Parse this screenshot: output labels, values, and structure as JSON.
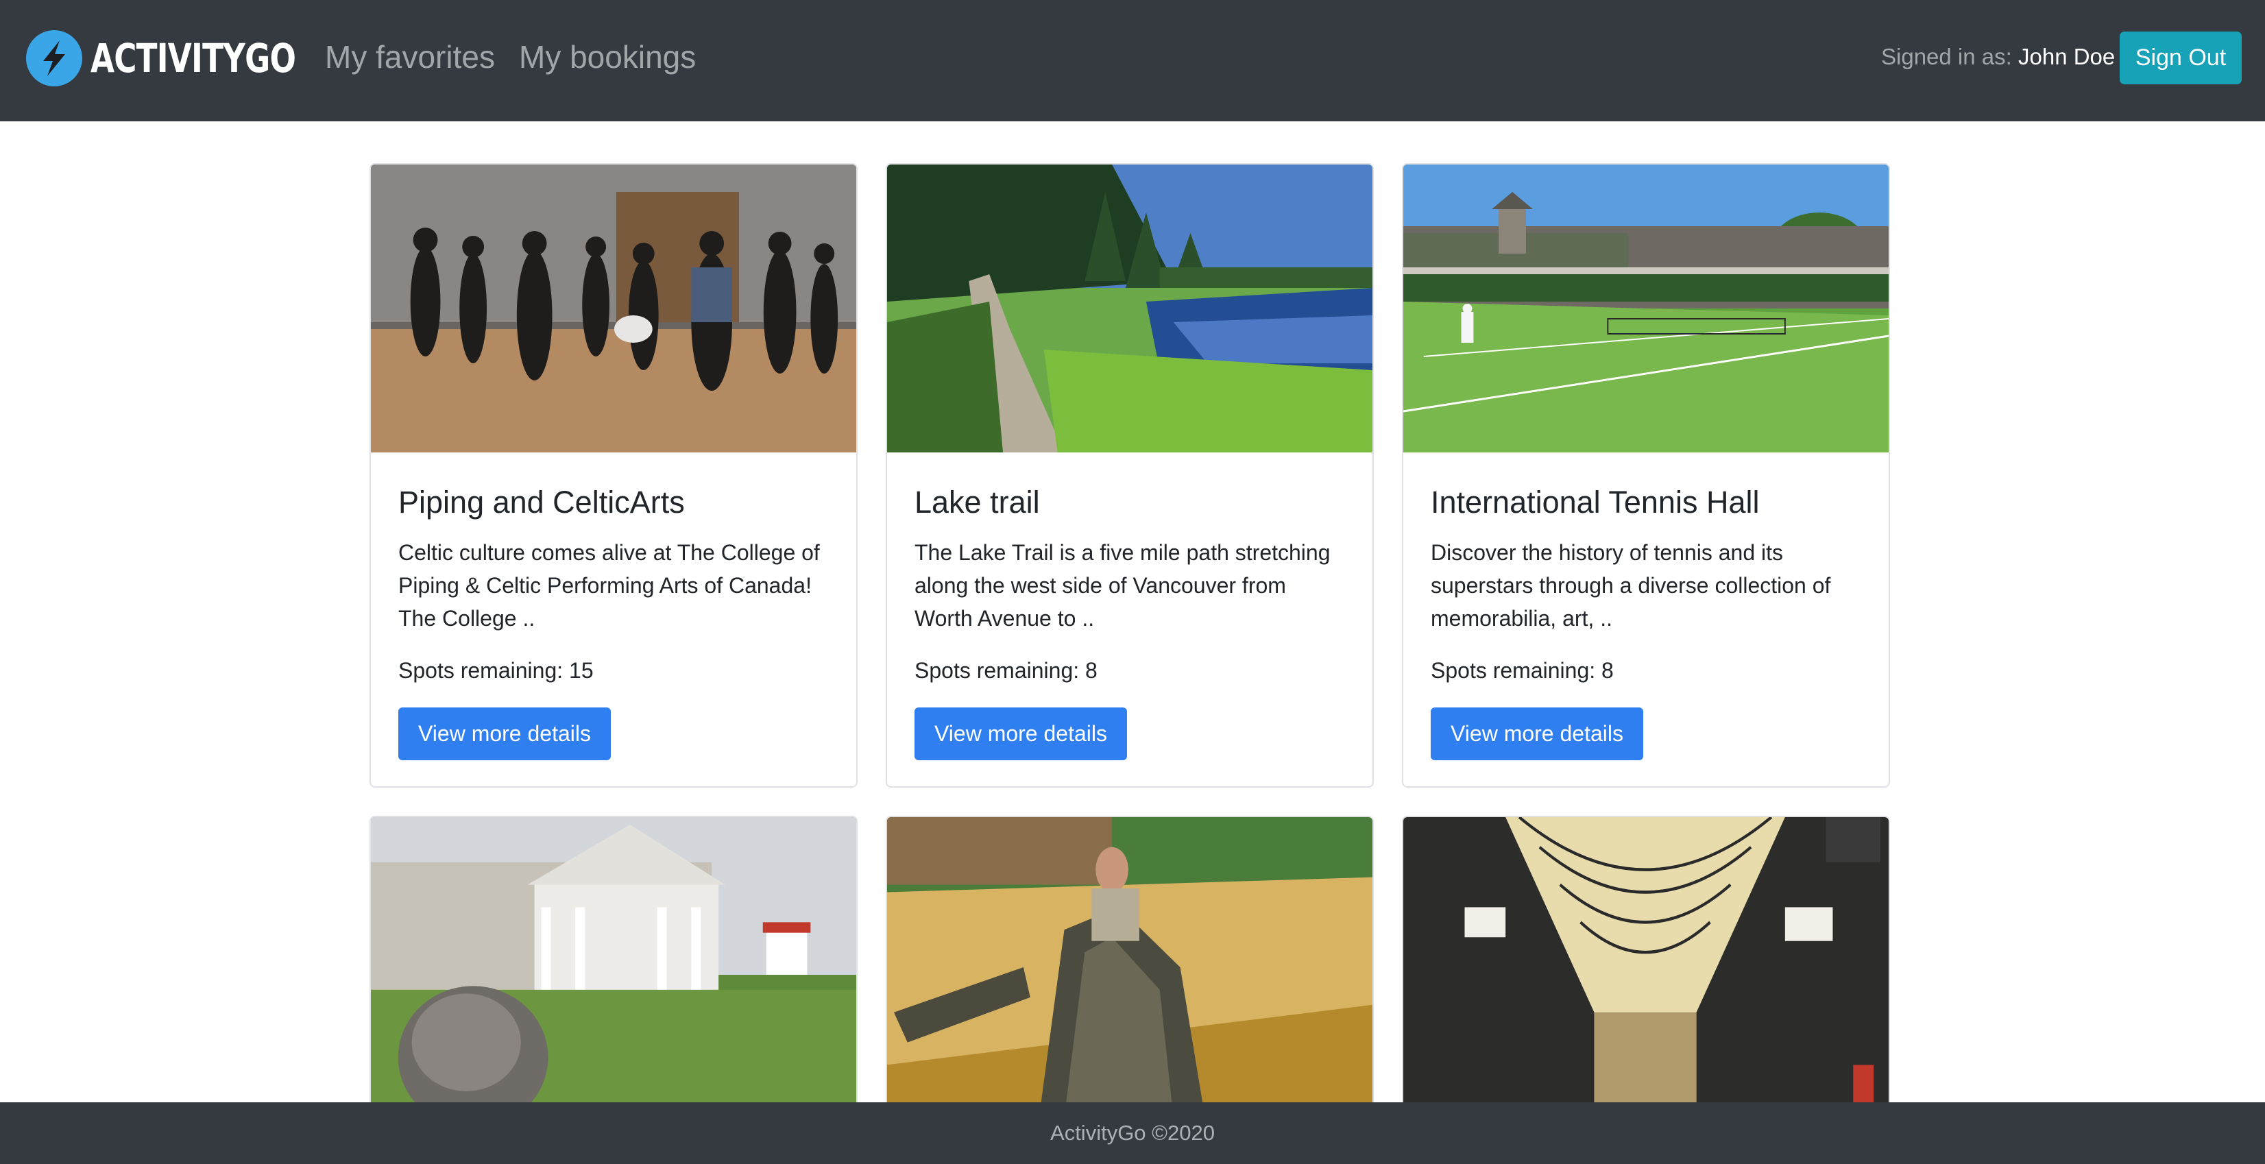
{
  "nav": {
    "brand": "ACTIVITYGO",
    "favorites": "My favorites",
    "bookings": "My bookings",
    "signed_in_label": "Signed in as:",
    "user": "John Doe",
    "signout": "Sign Out"
  },
  "cards": [
    {
      "title": "Piping and CelticArts",
      "description": "Celtic culture comes alive at The College of Piping & Celtic Performing Arts of Canada! The College ..",
      "spots": "Spots remaining: 15",
      "button": "View more details"
    },
    {
      "title": "Lake trail",
      "description": "The Lake Trail is a five mile path stretching along the west side of Vancouver from Worth Avenue to ..",
      "spots": "Spots remaining: 8",
      "button": "View more details"
    },
    {
      "title": "International Tennis Hall",
      "description": "Discover the history of tennis and its superstars through a diverse collection of memorabilia, art, ..",
      "spots": "Spots remaining: 8",
      "button": "View more details"
    }
  ],
  "footer": "ActivityGo ©2020",
  "colors": {
    "navbar": "#343a40",
    "primary": "#2f7ff0",
    "info": "#17a2b8",
    "logo": "#3aa6e8"
  }
}
